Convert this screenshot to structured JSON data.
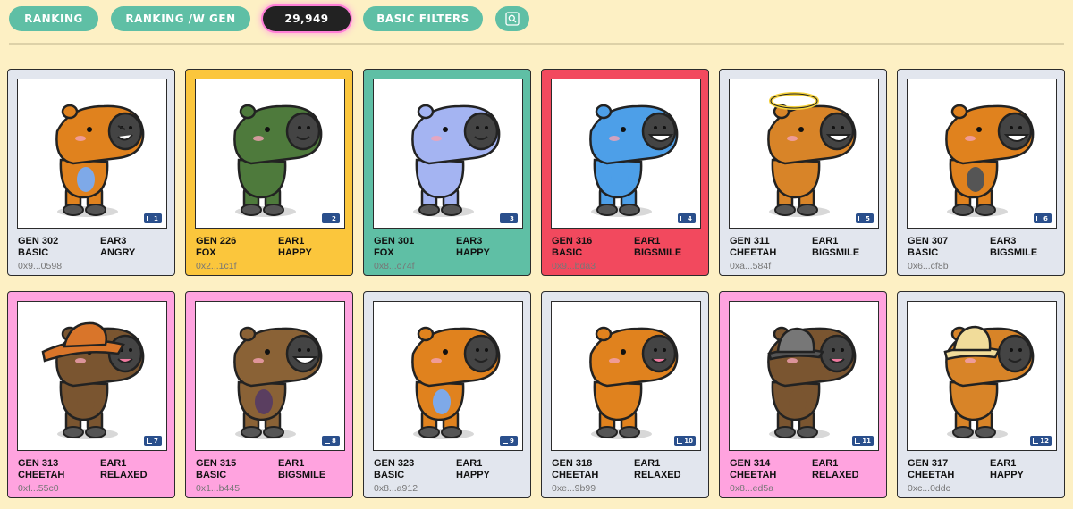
{
  "toolbar": {
    "ranking_label": "RANKING",
    "ranking_gen_label": "RANKING /W GEN",
    "count_label": "29,949",
    "basic_filters_label": "BASIC FILTERS",
    "search_icon": "search-icon"
  },
  "colors": {
    "basic": "#e2e6ee",
    "fox": "#fbc63c",
    "teal": "#5fbfa5",
    "red": "#f2495e",
    "pink": "#ffa3df"
  },
  "cards": [
    {
      "gen": "GEN 302",
      "type": "BASIC",
      "ear": "EAR3",
      "mood": "ANGRY",
      "addr": "0x9...0598",
      "rank": "1",
      "bg": "#e2e6ee",
      "body": "#e0821e",
      "belly": "#7ea9e8",
      "accessory": "none",
      "face": "angry"
    },
    {
      "gen": "GEN 226",
      "type": "FOX",
      "ear": "EAR1",
      "mood": "HAPPY",
      "addr": "0x2...1c1f",
      "rank": "2",
      "bg": "#fbc63c",
      "body": "#4e7a3c",
      "belly": "#4e7a3c",
      "accessory": "none",
      "face": "happy"
    },
    {
      "gen": "GEN 301",
      "type": "FOX",
      "ear": "EAR3",
      "mood": "HAPPY",
      "addr": "0x8...c74f",
      "rank": "3",
      "bg": "#5fbfa5",
      "body": "#a4b4f2",
      "belly": "#a4b4f2",
      "accessory": "none",
      "face": "happy"
    },
    {
      "gen": "GEN 316",
      "type": "BASIC",
      "ear": "EAR1",
      "mood": "BIGSMILE",
      "addr": "0x9...bda3",
      "rank": "4",
      "bg": "#f2495e",
      "body": "#4d9fe8",
      "belly": "#4d9fe8",
      "accessory": "none",
      "face": "bigsmile"
    },
    {
      "gen": "GEN 311",
      "type": "CHEETAH",
      "ear": "EAR1",
      "mood": "BIGSMILE",
      "addr": "0xa...584f",
      "rank": "5",
      "bg": "#e2e6ee",
      "body": "#d88428",
      "belly": "#d88428",
      "accessory": "halo",
      "face": "bigsmile"
    },
    {
      "gen": "GEN 307",
      "type": "BASIC",
      "ear": "EAR3",
      "mood": "BIGSMILE",
      "addr": "0x6...cf8b",
      "rank": "6",
      "bg": "#e2e6ee",
      "body": "#e0821e",
      "belly": "#555555",
      "accessory": "none",
      "face": "bigsmile"
    },
    {
      "gen": "GEN 313",
      "type": "CHEETAH",
      "ear": "EAR1",
      "mood": "RELAXED",
      "addr": "0xf...55c0",
      "rank": "7",
      "bg": "#ffa3df",
      "body": "#7a5530",
      "belly": "#7a5530",
      "accessory": "cowboy",
      "face": "relaxed"
    },
    {
      "gen": "GEN 315",
      "type": "BASIC",
      "ear": "EAR1",
      "mood": "BIGSMILE",
      "addr": "0x1...b445",
      "rank": "8",
      "bg": "#ffa3df",
      "body": "#8a6236",
      "belly": "#5a3e60",
      "accessory": "none",
      "face": "bigsmile"
    },
    {
      "gen": "GEN 323",
      "type": "BASIC",
      "ear": "EAR1",
      "mood": "HAPPY",
      "addr": "0x8...a912",
      "rank": "9",
      "bg": "#e2e6ee",
      "body": "#e0821e",
      "belly": "#7ea9e8",
      "accessory": "none",
      "face": "happy"
    },
    {
      "gen": "GEN 318",
      "type": "CHEETAH",
      "ear": "EAR1",
      "mood": "RELAXED",
      "addr": "0xe...9b99",
      "rank": "10",
      "bg": "#e2e6ee",
      "body": "#e0821e",
      "belly": "#e0821e",
      "accessory": "none",
      "face": "relaxed"
    },
    {
      "gen": "GEN 314",
      "type": "CHEETAH",
      "ear": "EAR1",
      "mood": "RELAXED",
      "addr": "0x8...ed5a",
      "rank": "11",
      "bg": "#ffa3df",
      "body": "#7a5530",
      "belly": "#7a5530",
      "accessory": "bowler",
      "face": "relaxed"
    },
    {
      "gen": "GEN 317",
      "type": "CHEETAH",
      "ear": "EAR1",
      "mood": "HAPPY",
      "addr": "0xc...0ddc",
      "rank": "12",
      "bg": "#e2e6ee",
      "body": "#d88428",
      "belly": "#d88428",
      "accessory": "safari",
      "face": "happy"
    }
  ]
}
